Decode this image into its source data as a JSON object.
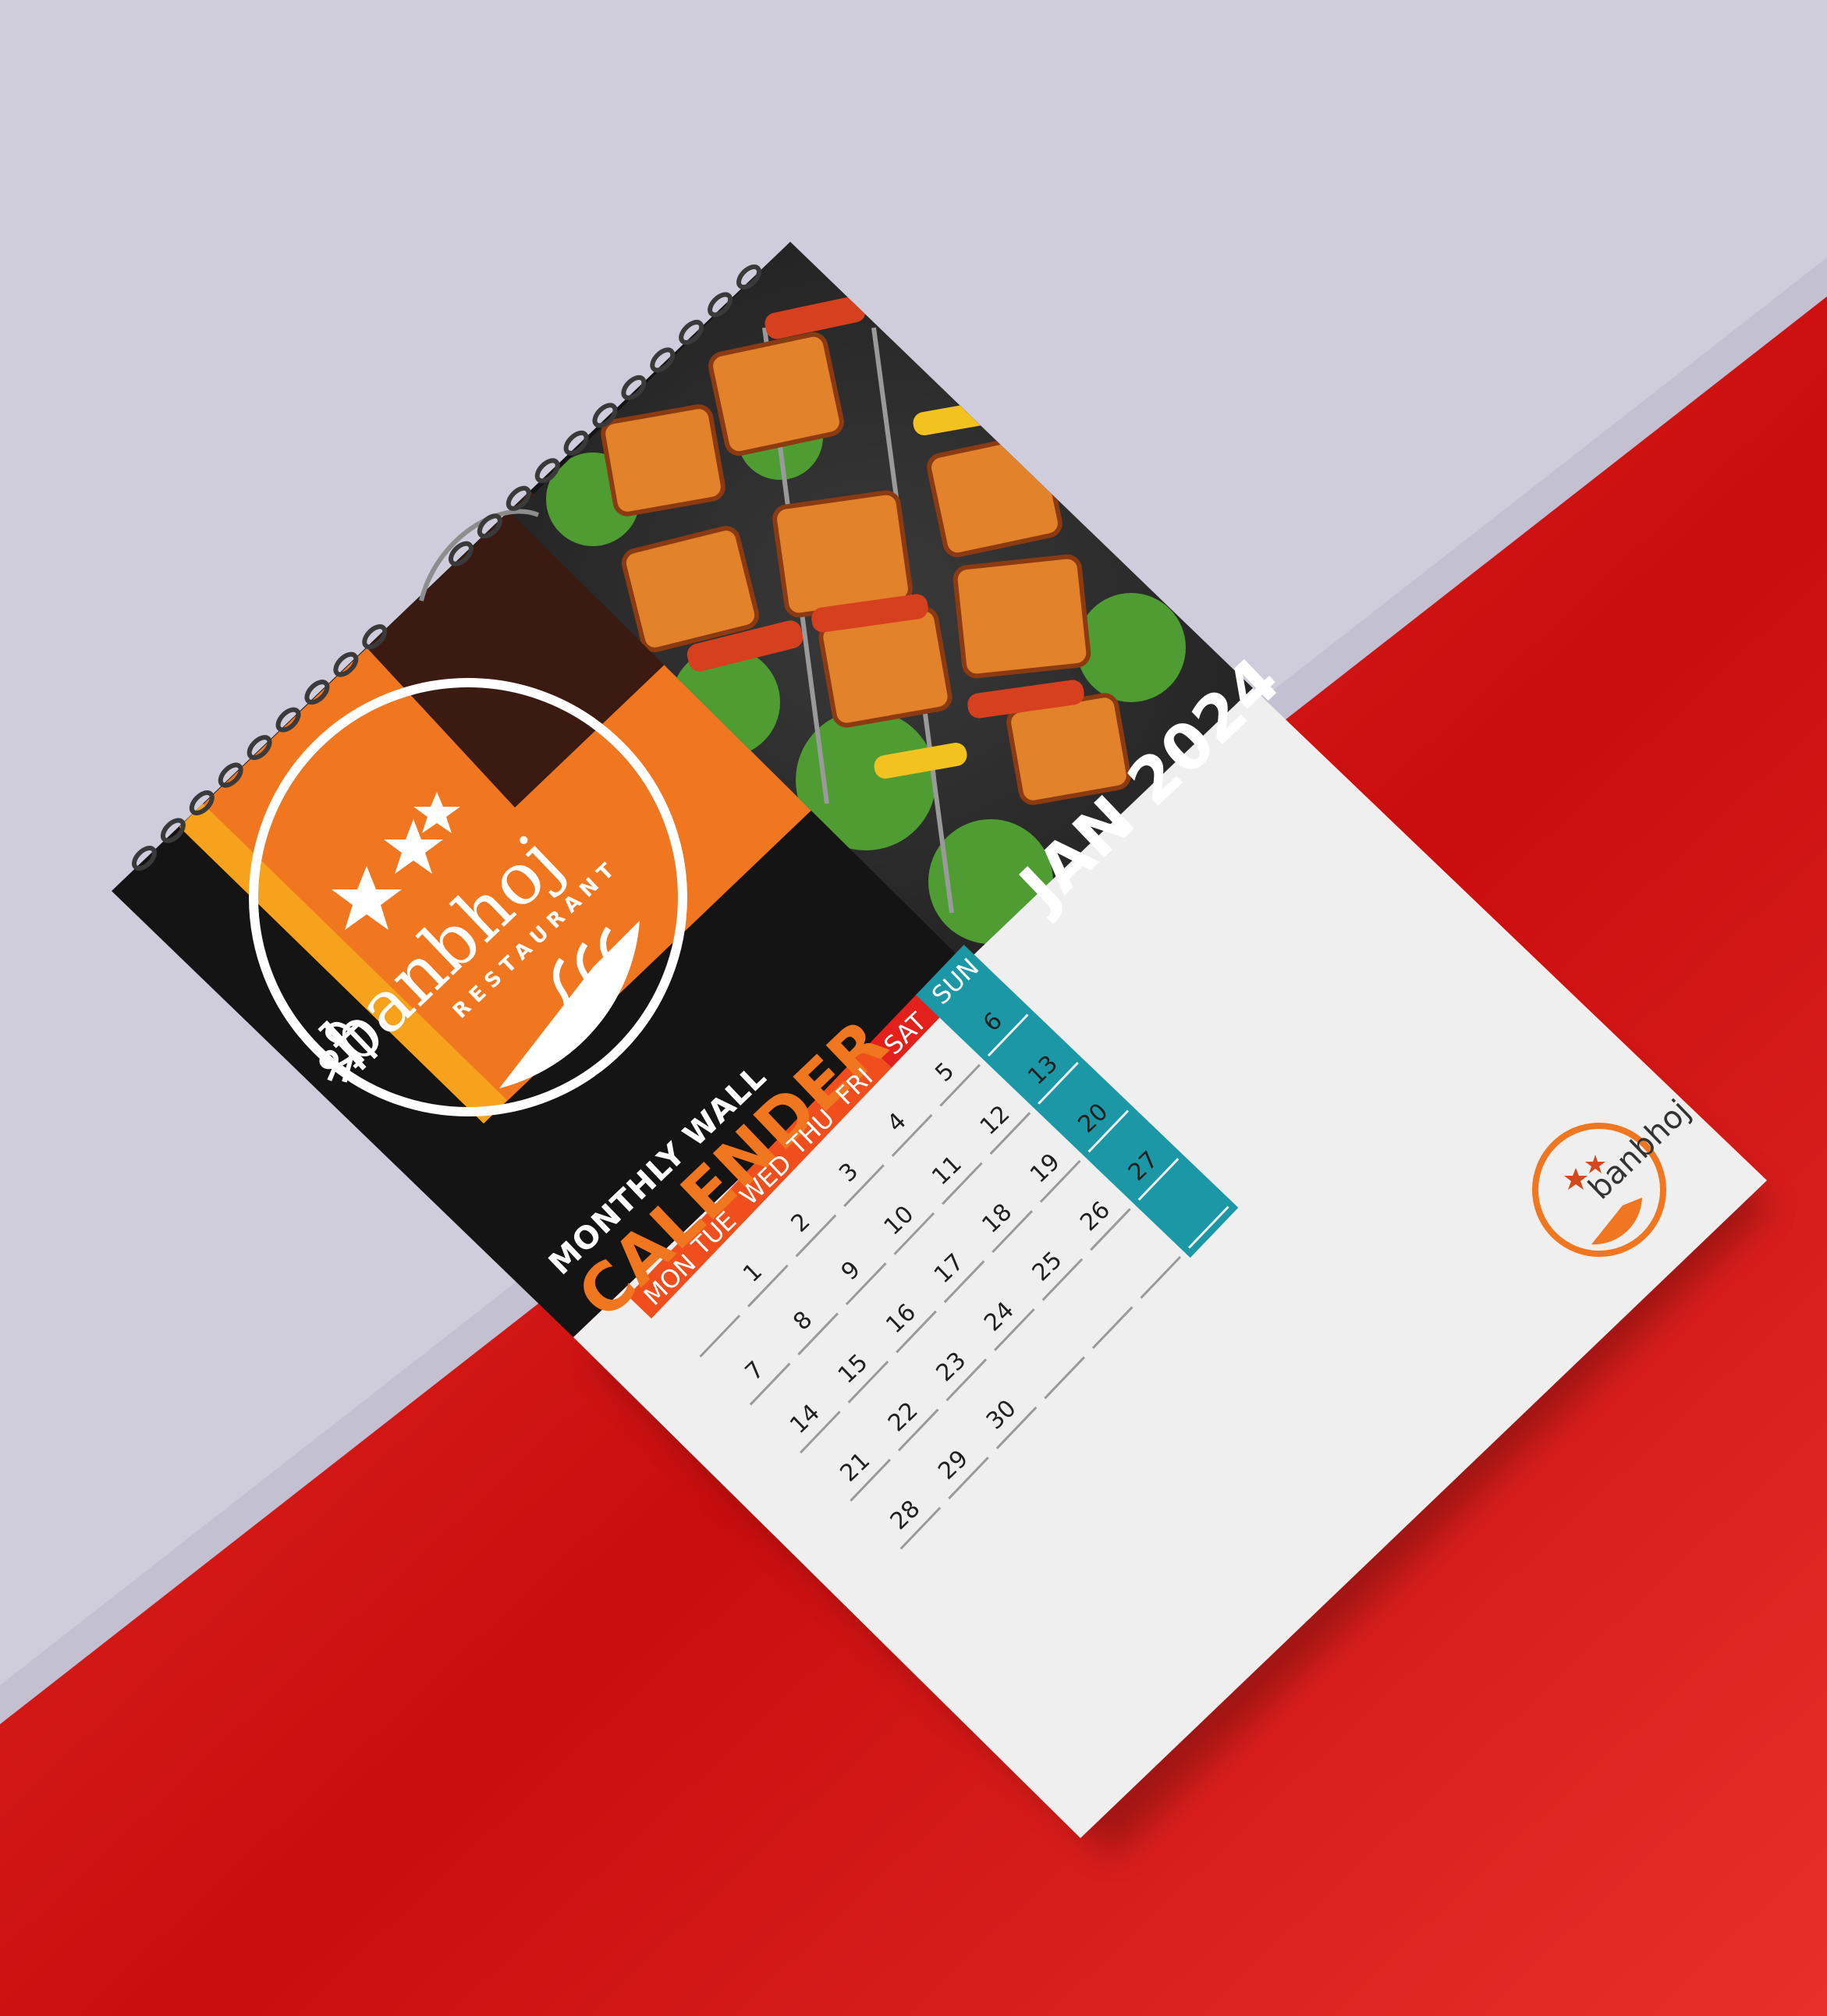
{
  "calendar": {
    "label_small": "MONTHLY WALL",
    "label_big": "CALENDER",
    "month_year": "JAN 2024",
    "brand_name": "banbhoj",
    "brand_sub": "RESTAURANT",
    "brand_prefix": "श्री",
    "days": [
      "MON",
      "TUE",
      "WED",
      "THU",
      "FRI",
      "SAT",
      "SUN"
    ],
    "weeks": [
      [
        "1",
        "2",
        "3",
        "4",
        "5",
        "6"
      ],
      [
        "7",
        "8",
        "9",
        "10",
        "11",
        "12",
        "13"
      ],
      [
        "14",
        "15",
        "16",
        "17",
        "18",
        "19",
        "20"
      ],
      [
        "21",
        "22",
        "23",
        "24",
        "25",
        "26",
        "27"
      ],
      [
        "28",
        "29",
        "30",
        "",
        "",
        "",
        ""
      ]
    ]
  },
  "colors": {
    "wall_lavender": "#cfcddc",
    "table_red": "#e3201c",
    "header_orange": "#f04e1c",
    "sunday_teal": "#1b97a5",
    "brand_orange": "#f0761f",
    "panel_black": "#141414",
    "page_white": "#efefef"
  }
}
